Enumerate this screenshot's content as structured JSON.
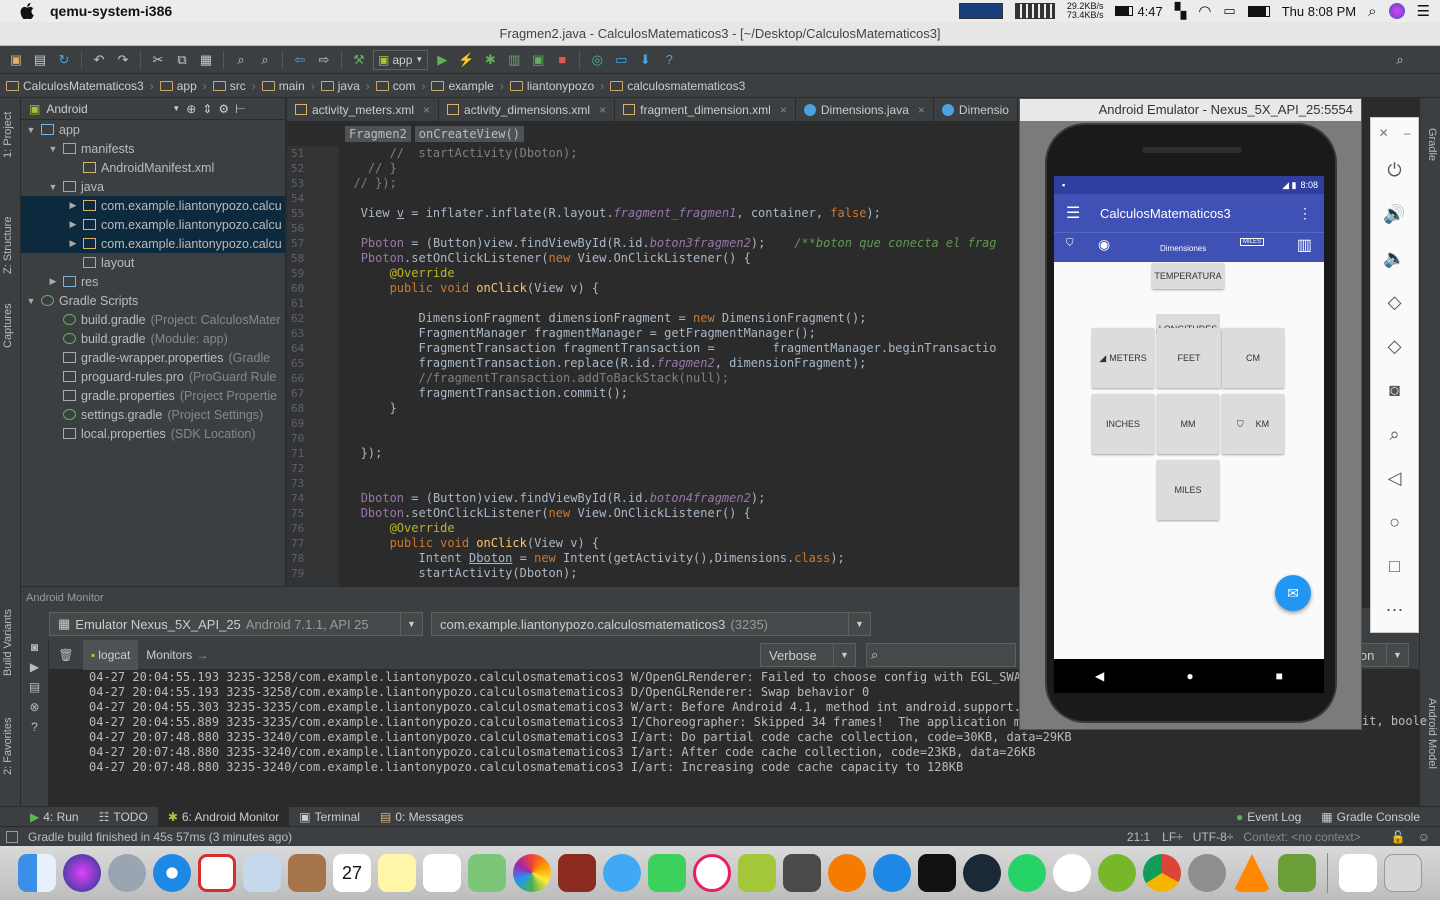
{
  "menubar": {
    "app": "qemu-system-i386",
    "net_up": "29.2KB/s",
    "net_down": "73.4KB/s",
    "battery_time": "4:47",
    "clock": "Thu 8:08 PM"
  },
  "window": {
    "title": "Fragmen2.java - CalculosMatematicos3 - [~/Desktop/CalculosMatematicos3]"
  },
  "toolbar": {
    "run_config": "app"
  },
  "breadcrumbs": [
    "CalculosMatematicos3",
    "app",
    "src",
    "main",
    "java",
    "com",
    "example",
    "liantonypozo",
    "calculosmatematicos3"
  ],
  "left_strip": {
    "project": "1: Project",
    "structure": "Z: Structure",
    "captures": "Captures",
    "build_variants": "Build Variants",
    "favorites": "2: Favorites"
  },
  "right_strip": {
    "gradle": "Gradle",
    "android_model": "Android Model"
  },
  "project": {
    "view": "Android",
    "tree": [
      {
        "label": "app",
        "hint": ""
      },
      {
        "label": "manifests",
        "hint": ""
      },
      {
        "label": "AndroidManifest.xml",
        "hint": ""
      },
      {
        "label": "java",
        "hint": ""
      },
      {
        "label": "com.example.liantonypozo.calcu",
        "hint": ""
      },
      {
        "label": "com.example.liantonypozo.calcu",
        "hint": ""
      },
      {
        "label": "com.example.liantonypozo.calcu",
        "hint": ""
      },
      {
        "label": "layout",
        "hint": ""
      },
      {
        "label": "res",
        "hint": ""
      },
      {
        "label": "Gradle Scripts",
        "hint": ""
      },
      {
        "label": "build.gradle",
        "hint": "(Project: CalculosMater"
      },
      {
        "label": "build.gradle",
        "hint": "(Module: app)"
      },
      {
        "label": "gradle-wrapper.properties",
        "hint": "(Gradle"
      },
      {
        "label": "proguard-rules.pro",
        "hint": "(ProGuard Rule"
      },
      {
        "label": "gradle.properties",
        "hint": "(Project Propertie"
      },
      {
        "label": "settings.gradle",
        "hint": "(Project Settings)"
      },
      {
        "label": "local.properties",
        "hint": "(SDK Location)"
      }
    ]
  },
  "editor": {
    "tabs": [
      "activity_meters.xml",
      "activity_dimensions.xml",
      "fragment_dimension.xml",
      "Dimensions.java",
      "Dimensio"
    ],
    "crumb_class": "Fragmen2",
    "crumb_method": "onCreateView()",
    "line_numbers": [
      "51",
      "52",
      "53",
      "54",
      "55",
      "56",
      "57",
      "58",
      "59",
      "60",
      "61",
      "62",
      "63",
      "64",
      "65",
      "66",
      "67",
      "68",
      "69",
      "70",
      "71",
      "72",
      "73",
      "74",
      "75",
      "76",
      "77",
      "78",
      "79"
    ]
  },
  "emulator": {
    "title": "Android Emulator - Nexus_5X_API_25:5554",
    "phone_time": "8:08",
    "app_title": "CalculosMatematicos3",
    "tab_dimensiones": "Dimensiones",
    "tab_miles": "MILES",
    "buttons": {
      "temperatura": "TEMPERATURA",
      "longitudes": "LONGITUDES",
      "meters": "METERS",
      "feet": "FEET",
      "cm": "CM",
      "inches": "INCHES",
      "mm": "MM",
      "km": "KM",
      "miles": "MILES"
    }
  },
  "monitor": {
    "title": "Android Monitor",
    "device": "Emulator Nexus_5X_API_25",
    "device_detail": "Android 7.1.1, API 25",
    "process": "com.example.liantonypozo.calculosmatematicos3",
    "pid": "(3235)",
    "tab_logcat": "logcat",
    "tab_monitors": "Monitors",
    "level": "Verbose",
    "filter_partial": "ion",
    "log_lines": [
      "04-27 20:04:55.193 3235-3258/com.example.liantonypozo.calculosmatematicos3 W/OpenGLRenderer: Failed to choose config with EGL_SWAP_BE",
      "04-27 20:04:55.193 3235-3258/com.example.liantonypozo.calculosmatematicos3 D/OpenGLRenderer: Swap behavior 0",
      "04-27 20:04:55.303 3235-3235/com.example.liantonypozo.calculosmatematicos3 W/art: Before Android 4.1, method int android.support.v7.w",
      "04-27 20:04:55.889 3235-3235/com.example.liantonypozo.calculosmatematicos3 I/Choreographer: Skipped 34 frames!  The application may be doing too much work on its main thread.",
      "04-27 20:07:48.880 3235-3240/com.example.liantonypozo.calculosmatematicos3 I/art: Do partial code cache collection, code=30KB, data=29KB",
      "04-27 20:07:48.880 3235-3240/com.example.liantonypozo.calculosmatematicos3 I/art: After code cache collection, code=23KB, data=26KB",
      "04-27 20:07:48.880 3235-3240/com.example.liantonypozo.calculosmatematicos3 I/art: Increasing code cache capacity to 128KB"
    ],
    "log_right_tail": "it, boole"
  },
  "bottom_tabs": {
    "run": "4: Run",
    "todo": "TODO",
    "android_monitor": "6: Android Monitor",
    "terminal": "Terminal",
    "messages": "0: Messages",
    "event_log": "Event Log",
    "gradle_console": "Gradle Console"
  },
  "status": {
    "message": "Gradle build finished in 45s 57ms (3 minutes ago)",
    "position": "21:1",
    "line_sep": "LF÷",
    "encoding": "UTF-8÷",
    "context": "Context: <no context>"
  },
  "colors": {
    "ide_bg": "#2b2b2b",
    "panel": "#3c3f41",
    "app_primary": "#3f51b5",
    "fab": "#2196f3"
  }
}
